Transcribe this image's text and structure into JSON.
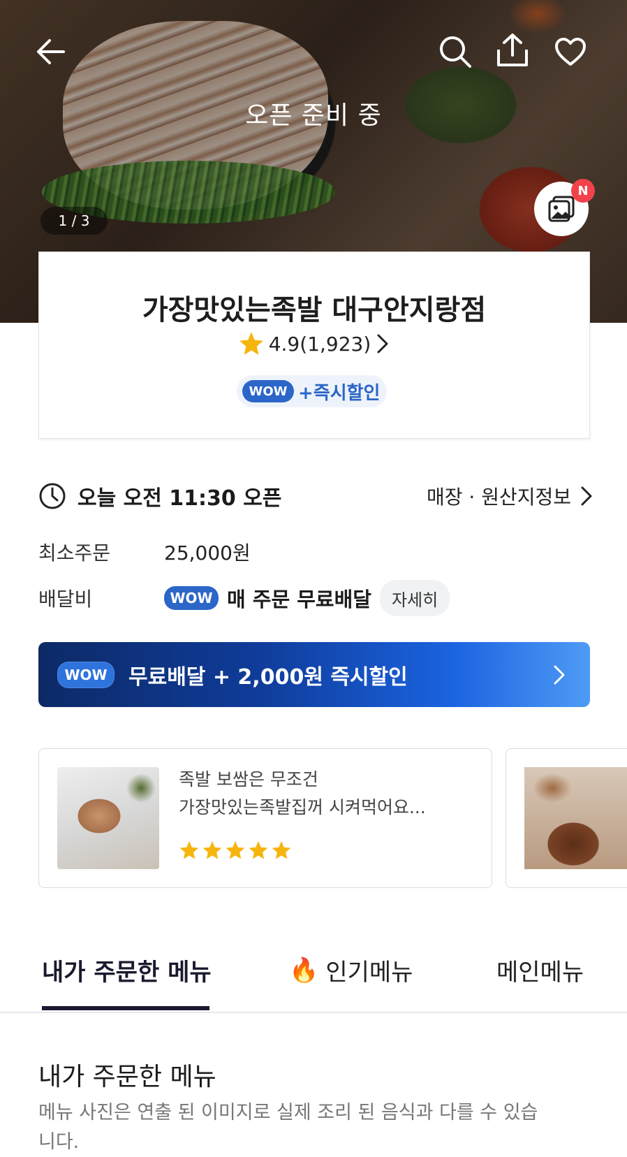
{
  "hero": {
    "status_overlay": "오픈 준비 중",
    "photo_counter": "1 / 3",
    "new_badge": "N"
  },
  "store": {
    "name": "가장맛있는족발 대구안지랑점",
    "rating": "4.9(1,923)",
    "wow_label": "WOW",
    "wow_discount": "+즉시할인"
  },
  "info": {
    "hours": "오늘 오전 11:30 오픈",
    "store_info_link": "매장 · 원산지정보",
    "min_order_label": "최소주문",
    "min_order_value": "25,000원",
    "delivery_fee_label": "배달비",
    "delivery_wow": "WOW",
    "delivery_value": "매 주문 무료배달",
    "detail_button": "자세히"
  },
  "banner": {
    "wow": "WOW",
    "text": "무료배달 + 2,000원 즉시할인"
  },
  "reviews": [
    {
      "line1": "족발 보쌈은 무조건",
      "line2": "가장맛있는족발집꺼 시켜먹어요...",
      "stars": 5
    }
  ],
  "tabs": [
    {
      "label": "내가 주문한 메뉴",
      "active": true
    },
    {
      "label": "인기메뉴",
      "icon": "🔥"
    },
    {
      "label": "메인메뉴"
    }
  ],
  "section": {
    "title": "내가 주문한 메뉴",
    "note": "메뉴 사진은 연출 된 이미지로 실제 조리 된 음식과 다를 수 있습니다."
  },
  "colors": {
    "wow_blue": "#2b66c8",
    "star_yellow": "#f6b50e",
    "badge_red": "#f2424a"
  }
}
